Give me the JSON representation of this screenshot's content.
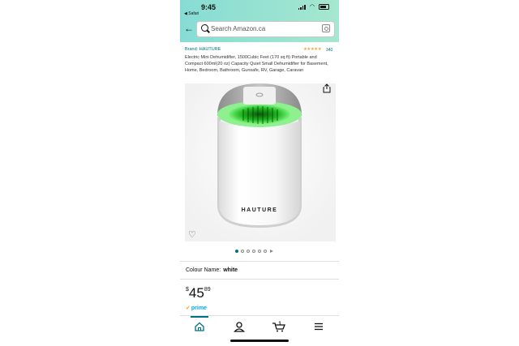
{
  "status_bar": {
    "time": "9:45",
    "back_app": "◀ Safari"
  },
  "search": {
    "placeholder": "Search Amazon.ca"
  },
  "product": {
    "brand": "Brand: HAUTURE",
    "rating_count": "340",
    "rating_stars": 4.5,
    "title": "Electric Mini Dehumidifier, 1500Cubic Feet (170 sq ft) Portable and Compact 600ml(20 oz) Capacity Quiet Small Dehumidifier for Basement, Home, Bedroom, Bathroom, Gunsafe, RV, Garage, Caravan",
    "image_brand_text": "HAUTURE",
    "image_count": 6,
    "active_image": 1,
    "color_label": "Colour Name:",
    "color_value": "white",
    "price_currency": "$",
    "price_whole": "45",
    "price_fraction": "89",
    "prime_label": "prime"
  },
  "nav": {
    "items": [
      {
        "name": "home",
        "icon": "home-icon",
        "active": true
      },
      {
        "name": "account",
        "icon": "person-icon",
        "active": false
      },
      {
        "name": "cart",
        "icon": "cart-icon",
        "active": false,
        "count": "1"
      },
      {
        "name": "menu",
        "icon": "menu-icon",
        "active": false
      }
    ]
  },
  "colors": {
    "accent": "#007185",
    "stars": "#f3a847",
    "prime": "#00a8e1",
    "header_gradient_start": "#86dcd4",
    "header_gradient_end": "#a6e7cf"
  }
}
